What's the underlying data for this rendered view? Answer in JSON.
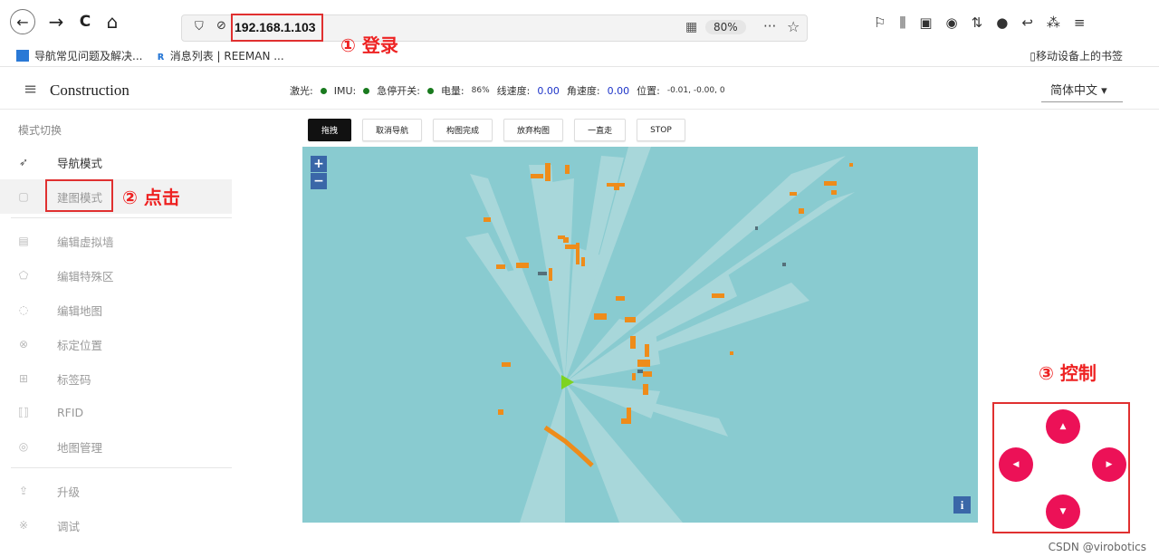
{
  "browser": {
    "back": "←",
    "forward": "→",
    "reload": "C",
    "home": "⌂",
    "url": "192.168.1.103",
    "zoom": "80%",
    "more": "···",
    "star": "☆",
    "toolbar_icons": [
      "⚐",
      "⫼",
      "▣",
      "◉",
      "⇅",
      "●",
      "↩",
      "⁂",
      "≡"
    ]
  },
  "bookmarks": {
    "item1": "导航常见问题及解决...",
    "item2": "消息列表 | REEMAN ...",
    "right": "移动设备上的书签"
  },
  "annotations": {
    "step1": "① 登录",
    "step2": "② 点击",
    "step3": "③ 控制"
  },
  "app": {
    "menu_icon": "≡",
    "title": "Construction",
    "language": "简体中文 ▾"
  },
  "status": {
    "laser_label": "激光:",
    "imu_label": "IMU:",
    "estop_label": "急停开关:",
    "battery_label": "电量:",
    "battery_value": "86%",
    "linear_label": "线速度:",
    "linear_value": "0.00",
    "angular_label": "角速度:",
    "angular_value": "0.00",
    "position_label": "位置:",
    "position_value": "-0.01, -0.00, 0",
    "indicator_color": "#197a1e"
  },
  "sidebar": {
    "header": "模式切换",
    "items": [
      {
        "icon": "➶",
        "label": "导航模式"
      },
      {
        "icon": "▢",
        "label": "建图模式"
      },
      {
        "icon": "▤",
        "label": "编辑虚拟墙"
      },
      {
        "icon": "⬠",
        "label": "编辑特殊区"
      },
      {
        "icon": "◌",
        "label": "编辑地图"
      },
      {
        "icon": "⊗",
        "label": "标定位置"
      },
      {
        "icon": "⊞",
        "label": "标签码"
      },
      {
        "icon": "⟦⟧",
        "label": "RFID"
      },
      {
        "icon": "◎",
        "label": "地图管理"
      },
      {
        "icon": "⇪",
        "label": "升级"
      },
      {
        "icon": "※",
        "label": "调试"
      }
    ]
  },
  "toolbar": {
    "buttons": [
      "拖拽",
      "取消导航",
      "构图完成",
      "放弃构图",
      "一直走",
      "STOP"
    ]
  },
  "map": {
    "zoom_in": "+",
    "zoom_out": "−",
    "info": "i",
    "background": "#89cbd0",
    "obstacle_color": "#ee8c1a",
    "robot_color": "#7ed321"
  },
  "controls": {
    "up": "▲",
    "down": "▼",
    "left": "◀",
    "right": "▶",
    "color": "#ec1157"
  },
  "watermark": "CSDN @virobotics"
}
